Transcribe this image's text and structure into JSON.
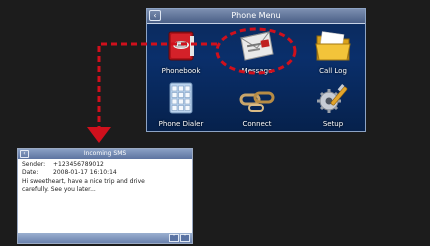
{
  "phone_menu": {
    "title": "Phone Menu",
    "back_icon": "chevron-left-icon",
    "items": [
      {
        "label": "Phonebook",
        "icon": "phonebook-icon"
      },
      {
        "label": "Message",
        "icon": "message-icon"
      },
      {
        "label": "Call Log",
        "icon": "call-log-icon"
      },
      {
        "label": "Phone Dialer",
        "icon": "keypad-icon"
      },
      {
        "label": "Connect",
        "icon": "chain-link-icon"
      },
      {
        "label": "Setup",
        "icon": "wrench-gear-icon"
      }
    ]
  },
  "incoming_sms": {
    "title": "Incoming SMS",
    "back_icon": "chevron-left-icon",
    "sender_label": "Sender:",
    "sender_value": "+123456789012",
    "date_label": "Date:",
    "date_value": "2008-01-17 16:10:14",
    "message": "Hi sweetheart, have a nice trip and drive carefully. See you later...",
    "scroll_up_icon": "chevron-up-icon",
    "scroll_down_icon": "chevron-down-icon"
  },
  "colors": {
    "annotation": "#d0101c",
    "menu_background": "#0a2f6b",
    "titlebar": "#5d74a0"
  }
}
